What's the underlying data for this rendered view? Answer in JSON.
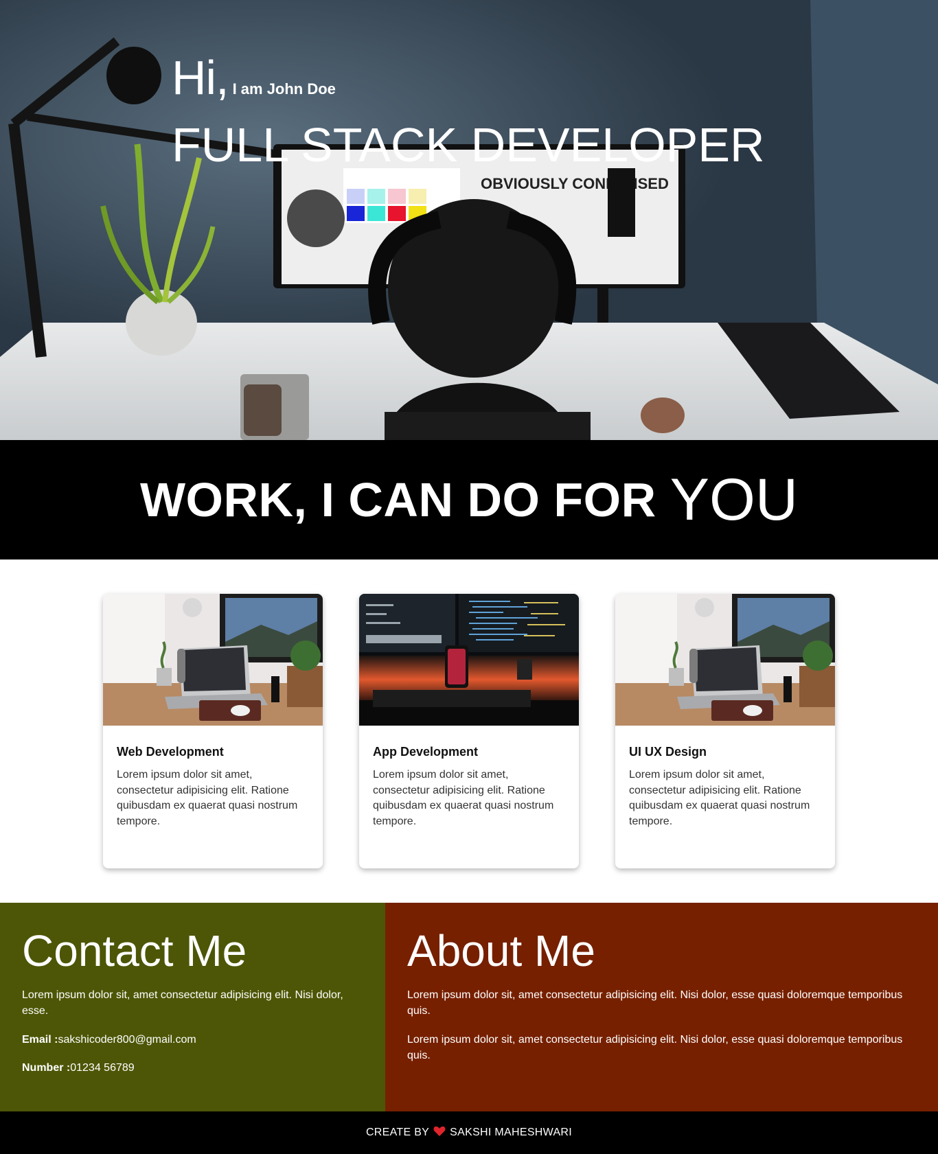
{
  "hero": {
    "greeting": "Hi,",
    "name": "I am John Doe",
    "role": "FULL STACK DEVELOPER",
    "monitor_heading": "OBVIOUSLY CONDENSED"
  },
  "banner": {
    "strong_text": "WORK, I CAN DO FOR",
    "big_text": "YOU"
  },
  "services": [
    {
      "title": "Web Development",
      "text": "Lorem ipsum dolor sit amet, consectetur adipisicing elit. Ratione quibusdam ex quaerat quasi nostrum tempore.",
      "image": "desk-laptop-photo"
    },
    {
      "title": "App Development",
      "text": "Lorem ipsum dolor sit amet, consectetur adipisicing elit. Ratione quibusdam ex quaerat quasi nostrum tempore.",
      "image": "code-monitors-photo"
    },
    {
      "title": "UI UX Design",
      "text": "Lorem ipsum dolor sit amet, consectetur adipisicing elit. Ratione quibusdam ex quaerat quasi nostrum tempore.",
      "image": "desk-laptop-photo"
    }
  ],
  "contact": {
    "heading": "Contact Me",
    "text": "Lorem ipsum dolor sit, amet consectetur adipisicing elit. Nisi dolor, esse.",
    "email_label": "Email :",
    "email_value": "sakshicoder800@gmail.com",
    "number_label": "Number :",
    "number_value": "01234 56789",
    "bg_color": "#4d5606"
  },
  "about": {
    "heading": "About Me",
    "para1": "Lorem ipsum dolor sit, amet consectetur adipisicing elit. Nisi dolor, esse quasi doloremque temporibus quis.",
    "para2": "Lorem ipsum dolor sit, amet consectetur adipisicing elit. Nisi dolor, esse quasi doloremque temporibus quis.",
    "bg_color": "#762000"
  },
  "footer": {
    "prefix": "CREATE BY",
    "heart": "❤",
    "author": "SAKSHI MAHESHWARI"
  }
}
